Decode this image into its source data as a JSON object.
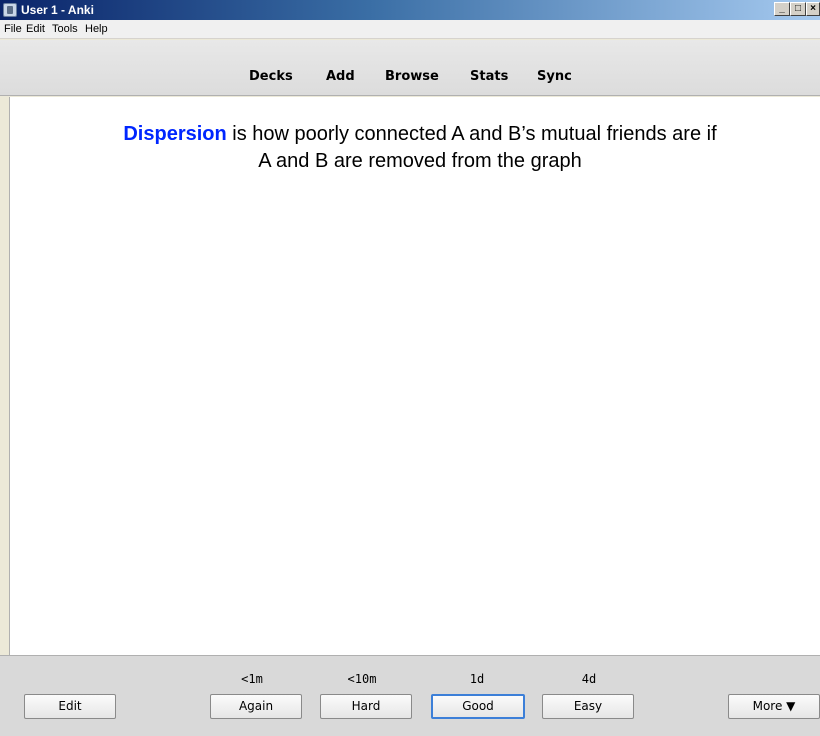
{
  "window": {
    "title": "User 1 - Anki",
    "min_glyph": "_",
    "max_glyph": "□",
    "close_glyph": "×"
  },
  "menu": {
    "items": [
      "File",
      "Edit",
      "Tools",
      "Help"
    ]
  },
  "toolbar": {
    "links": [
      "Decks",
      "Add",
      "Browse",
      "Stats",
      "Sync"
    ]
  },
  "card": {
    "term": "Dispersion",
    "text_line1_rest": " is how poorly connected A and B’s mutual friends are if",
    "text_line2": "A and B are removed from the graph",
    "term_color": "#0026ff"
  },
  "answer_bar": {
    "edit_label": "Edit",
    "more_label": "More ▼",
    "intervals": {
      "again": "<1m",
      "hard": "<10m",
      "good": "1d",
      "easy": "4d"
    },
    "buttons": {
      "again": "Again",
      "hard": "Hard",
      "good": "Good",
      "easy": "Easy"
    },
    "focused_button": "good",
    "focus_color": "#3c7fd8"
  }
}
